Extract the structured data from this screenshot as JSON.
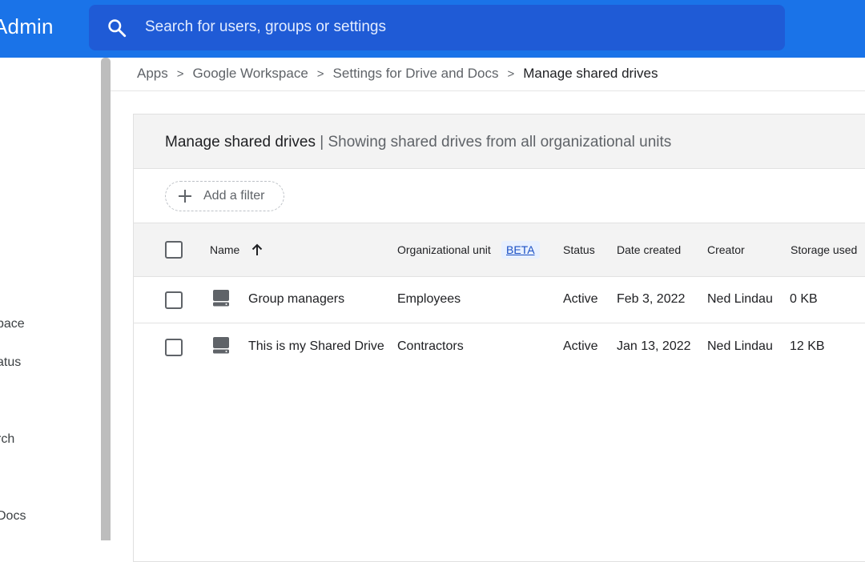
{
  "header": {
    "title": "Admin",
    "search_placeholder": "Search for users, groups or settings",
    "icons": {
      "search": "search-icon"
    }
  },
  "sidebar": {
    "items": [
      {
        "label": "pace"
      },
      {
        "label": "atus"
      },
      {
        "label": "rch"
      },
      {
        "label": "Docs"
      }
    ]
  },
  "breadcrumb": {
    "items": [
      "Apps",
      "Google Workspace",
      "Settings for Drive and Docs"
    ],
    "current": "Manage shared drives",
    "separator": ">"
  },
  "card": {
    "title": "Manage shared drives",
    "divider": "|",
    "subtitle": "Showing shared drives from all organizational units",
    "add_filter_label": "Add a filter"
  },
  "table": {
    "columns": {
      "name": "Name",
      "org_unit": "Organizational unit",
      "beta": "BETA",
      "status": "Status",
      "date_created": "Date created",
      "creator": "Creator",
      "storage_used": "Storage used"
    },
    "rows": [
      {
        "name": "Group managers",
        "org_unit": "Employees",
        "status": "Active",
        "date_created": "Feb 3, 2022",
        "creator": "Ned Lindau",
        "storage": "0 KB"
      },
      {
        "name": "This is my Shared Drive",
        "org_unit": "Contractors",
        "status": "Active",
        "date_created": "Jan 13, 2022",
        "creator": "Ned Lindau",
        "storage": "12 KB"
      }
    ]
  },
  "colors": {
    "appbar": "#1a73e8",
    "search_bg": "#1f5bd6",
    "beta_bg": "#e8f0fe",
    "beta_text": "#1a4fc4"
  }
}
